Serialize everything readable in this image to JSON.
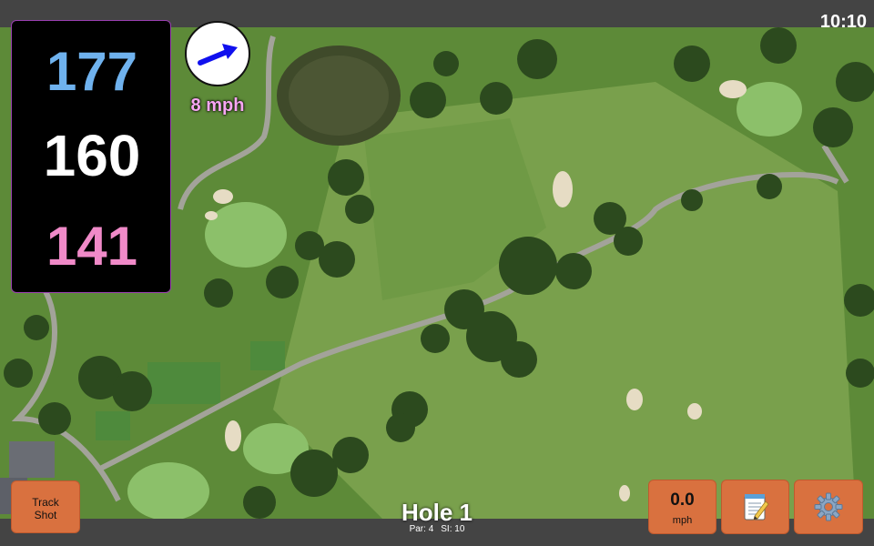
{
  "status_bar": {
    "time": "10:10"
  },
  "distances": {
    "back": {
      "value": "177",
      "color": "#6fb2ee"
    },
    "middle": {
      "value": "160",
      "color": "#ffffff"
    },
    "front": {
      "value": "141",
      "color": "#f08ac8"
    }
  },
  "wind": {
    "speed_label": "8 mph",
    "label_color": "#f7a6f2",
    "direction_icon": "arrow-icon",
    "arrow_color": "#1010ee"
  },
  "map": {
    "imagery": "aerial golf course"
  },
  "hole": {
    "title": "Hole 1",
    "par_label": "Par: 4",
    "si_label": "SI: 10"
  },
  "buttons": {
    "track_shot": {
      "label": "Track\nShot"
    },
    "speed": {
      "value": "0.0",
      "unit": "mph"
    },
    "notes": {
      "icon": "notepad-icon"
    },
    "settings": {
      "icon": "gear-icon"
    }
  },
  "colors": {
    "button_bg": "#d9713f",
    "panel_border": "#9a3fb0",
    "bar_bg": "#444444"
  }
}
